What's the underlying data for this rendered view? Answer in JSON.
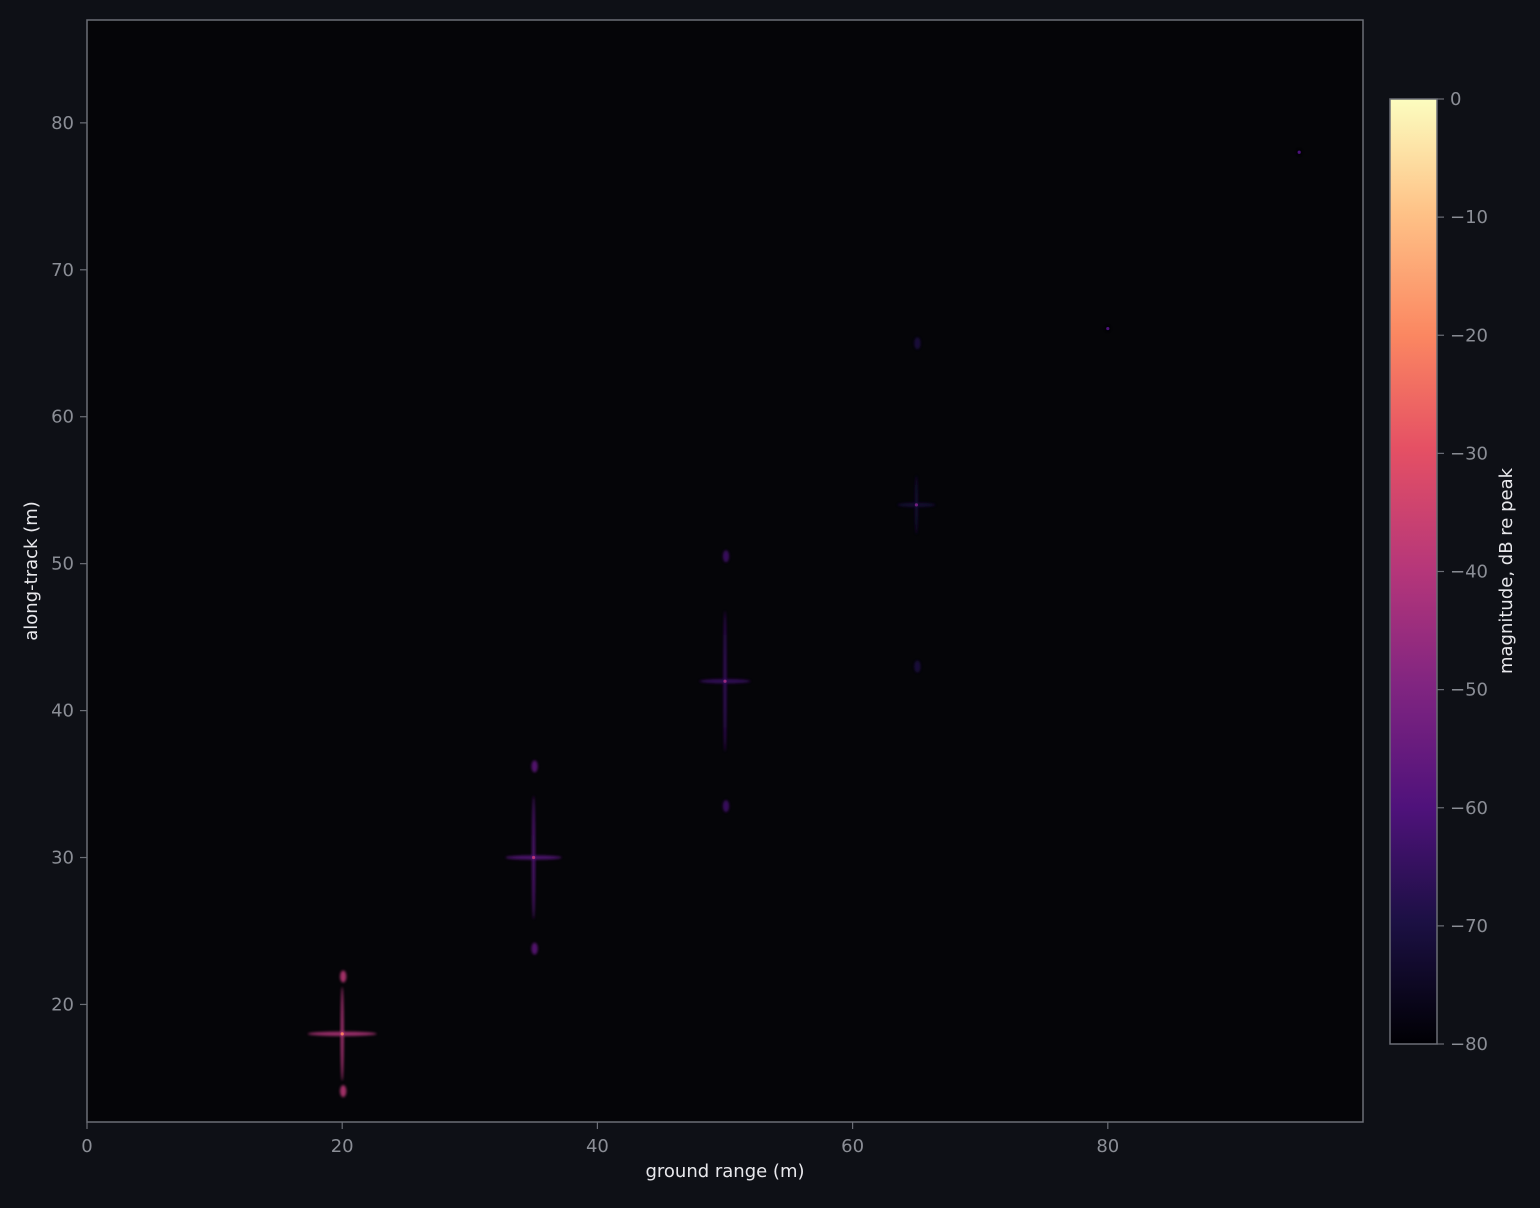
{
  "colors": {
    "page_bg": "#0e1016",
    "plot_bg": "#050508",
    "frame": "#6b6e76",
    "tick_text": "#8b8e96",
    "label_text": "#e8e8ec",
    "colormap": "magma"
  },
  "chart_data": {
    "type": "heatmap",
    "title": "",
    "xlabel": "ground range (m)",
    "ylabel": "along-track (m)",
    "xlim": [
      0,
      100
    ],
    "ylim": [
      12,
      87
    ],
    "xticks": [
      0,
      20,
      40,
      60,
      80
    ],
    "yticks": [
      20,
      30,
      40,
      50,
      60,
      70,
      80
    ],
    "grid": false,
    "colorbar": {
      "label": "magnitude, dB re peak",
      "range": [
        -80,
        0
      ],
      "ticks": [
        0,
        -10,
        -20,
        -30,
        -40,
        -50,
        -60,
        -70,
        -80
      ],
      "colormap": "magma"
    },
    "point_targets": [
      {
        "x": 20,
        "y": 18,
        "peak_db": -42,
        "range_arm_m": 2.7,
        "along_arm_m": 3.2,
        "grating_offset_m": 3.9
      },
      {
        "x": 35,
        "y": 30,
        "peak_db": -60,
        "range_arm_m": 2.2,
        "along_arm_m": 4.2,
        "grating_offset_m": 6.2
      },
      {
        "x": 50,
        "y": 42,
        "peak_db": -66,
        "range_arm_m": 2.0,
        "along_arm_m": 4.8,
        "grating_offset_m": 8.5
      },
      {
        "x": 65,
        "y": 54,
        "peak_db": -73,
        "range_arm_m": 1.5,
        "along_arm_m": 2.0,
        "grating_offset_m": 11.0
      },
      {
        "x": 80,
        "y": 66,
        "peak_db": -80,
        "range_arm_m": 0.2,
        "along_arm_m": 0.2,
        "grating_offset_m": 0
      },
      {
        "x": 95,
        "y": 78,
        "peak_db": -80,
        "range_arm_m": 0.2,
        "along_arm_m": 0.2,
        "grating_offset_m": 0
      }
    ]
  }
}
